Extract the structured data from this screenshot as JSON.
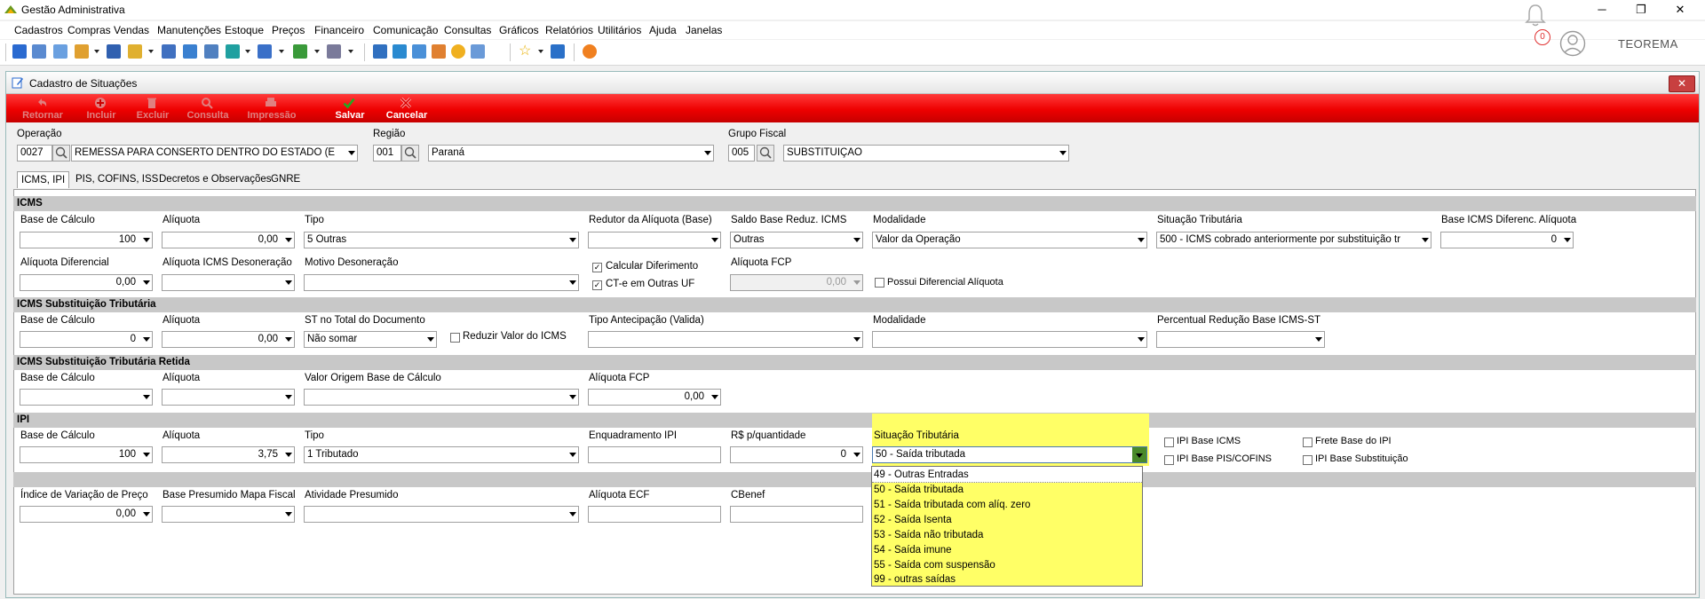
{
  "app": {
    "title": "Gestão Administrativa",
    "brand": "TEOREMA",
    "notifications": "0"
  },
  "menu": [
    "Cadastros",
    "Compras",
    "Vendas",
    "Manutenções",
    "Estoque",
    "Preços",
    "Financeiro",
    "Comunicação",
    "Consultas",
    "Gráficos",
    "Relatórios",
    "Utilitários",
    "Ajuda",
    "Janelas"
  ],
  "window": {
    "title": "Cadastro de Situações",
    "close": "✕",
    "actions": {
      "retornar": "Retornar",
      "incluir": "Incluir",
      "excluir": "Excluir",
      "consulta": "Consulta",
      "impressao": "Impressão",
      "salvar": "Salvar",
      "cancelar": "Cancelar"
    }
  },
  "header": {
    "operacao_label": "Operação",
    "operacao_code": "0027",
    "operacao_value": "REMESSA PARA CONSERTO  DENTRO DO ESTADO (E",
    "regiao_label": "Região",
    "regiao_code": "001",
    "regiao_value": "Paraná",
    "grupo_label": "Grupo Fiscal",
    "grupo_code": "005",
    "grupo_value": "SUBSTITUIÇAO"
  },
  "tabs": [
    "ICMS, IPI",
    "PIS, COFINS, ISS",
    "Decretos e Observações",
    "GNRE"
  ],
  "icms": {
    "title": "ICMS",
    "base_calculo_label": "Base de Cálculo",
    "base_calculo": "100",
    "aliquota_label": "Alíquota",
    "aliquota": "0,00",
    "tipo_label": "Tipo",
    "tipo": "5 Outras",
    "redutor_label": "Redutor da Alíquota (Base)",
    "redutor": "",
    "saldo_label": "Saldo Base Reduz. ICMS",
    "saldo": "Outras",
    "modalidade_label": "Modalidade",
    "modalidade": "Valor da Operação",
    "situacao_label": "Situação Tributária",
    "situacao": "500 - ICMS cobrado anteriormente por substituição tr",
    "base_dif_label": "Base ICMS Diferenc. Alíquota",
    "base_dif": "0",
    "aliq_dif_label": "Alíquota Diferencial",
    "aliq_dif": "0,00",
    "aliq_deson_label": "Alíquota ICMS Desoneração",
    "aliq_deson": "",
    "motivo_label": "Motivo Desoneração",
    "motivo": "",
    "calc_difer_label": "Calcular Diferimento",
    "calc_difer": "✓",
    "cte_label": "CT-e em Outras UF",
    "cte": "✓",
    "aliq_fcp_label": "Alíquota FCP",
    "aliq_fcp": "0,00",
    "possui_dif_label": "Possui Diferencial Alíquota",
    "possui_dif": ""
  },
  "st": {
    "title": "ICMS Substituição Tributária",
    "base_label": "Base de Cálculo",
    "base": "0",
    "aliquota_label": "Alíquota",
    "aliquota": "0,00",
    "st_total_label": "ST no Total do Documento",
    "st_total": "Não somar",
    "reduzir_label": "Reduzir Valor do ICMS",
    "reduzir": "",
    "antecip_label": "Tipo Antecipação (Valida)",
    "antecip": "",
    "modalidade_label": "Modalidade",
    "modalidade": "",
    "perc_label": "Percentual Redução Base ICMS-ST",
    "perc": ""
  },
  "st_retida": {
    "title": "ICMS Substituição Tributária Retida",
    "base_label": "Base de Cálculo",
    "base": "",
    "aliquota_label": "Alíquota",
    "aliquota": "",
    "valor_origem_label": "Valor Origem Base de Cálculo",
    "valor_origem": "",
    "aliq_fcp_label": "Alíquota FCP",
    "aliq_fcp": "0,00"
  },
  "ipi": {
    "title": "IPI",
    "base_label": "Base de Cálculo",
    "base": "100",
    "aliquota_label": "Alíquota",
    "aliquota": "3,75",
    "tipo_label": "Tipo",
    "tipo": "1 Tributado",
    "enquad_label": "Enquadramento IPI",
    "enquad": "",
    "rs_label": "R$ p/quantidade",
    "rs": "0",
    "situacao_label": "Situação Tributária",
    "situacao": "50 - Saída tributada",
    "base_icms_label": "IPI Base ICMS",
    "base_pis_label": "IPI Base PIS/COFINS",
    "frete_label": "Frete Base do IPI",
    "base_subst_label": "IPI Base Substituição",
    "options": [
      "49 - Outras Entradas",
      "50 - Saída tributada",
      "51 - Saída tributada com alíq. zero",
      "52 - Saída Isenta",
      "53 - Saída não tributada",
      "54 - Saída imune",
      "55 - Saída com suspensão",
      "99 - outras saídas"
    ]
  },
  "other": {
    "indice_label": "Índice de Variação de Preço",
    "indice": "0,00",
    "base_pres_label": "Base Presumido Mapa Fiscal",
    "base_pres": "",
    "ativ_label": "Atividade Presumido",
    "ativ": "",
    "aliq_ecf_label": "Alíquota ECF",
    "aliq_ecf": "",
    "cbenef_label": "CBenef",
    "cbenef": ""
  },
  "colors": {
    "highlight": "#ffff66",
    "action_bar": "#ee0000",
    "save_icon": "#22aa22",
    "cancel_icon": "#dd0000"
  }
}
